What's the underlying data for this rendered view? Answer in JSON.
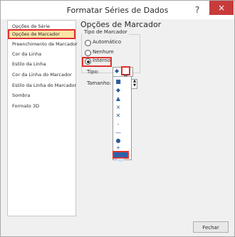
{
  "window": {
    "title": "Formatar Séries de Dados",
    "help": "?",
    "close": "×"
  },
  "sidebar": {
    "items": [
      {
        "label": "Opções de Série"
      },
      {
        "label": "Opções de Marcador"
      },
      {
        "label": "Preenchimento de Marcador"
      },
      {
        "label": "Cor da Linha"
      },
      {
        "label": "Estilo da Linha"
      },
      {
        "label": "Cor da Linha do Marcador"
      },
      {
        "label": "Estilo da Linha do Marcador"
      },
      {
        "label": "Sombra"
      },
      {
        "label": "Formato 3D"
      }
    ],
    "selected_index": 1
  },
  "main": {
    "title": "Opções de Marcador",
    "marker_type_group": "Tipo de Marcador",
    "options": [
      {
        "label": "Automático"
      },
      {
        "label": "Nenhum"
      },
      {
        "label": "Interno",
        "checked": true
      }
    ],
    "type_label": "Tipo:",
    "size_label": "Tamanho:",
    "type_current": "◆",
    "spinner_up": "▲",
    "spinner_down": "▼",
    "dropdown_items": [
      {
        "glyph": "■",
        "icon": "square-marker-icon"
      },
      {
        "glyph": "◆",
        "icon": "diamond-marker-icon"
      },
      {
        "glyph": "▲",
        "icon": "triangle-marker-icon"
      },
      {
        "glyph": "×",
        "icon": "x-marker-icon"
      },
      {
        "glyph": "✕",
        "icon": "star-marker-icon"
      },
      {
        "glyph": "-",
        "icon": "short-dash-marker-icon"
      },
      {
        "glyph": "—",
        "icon": "long-dash-marker-icon"
      },
      {
        "glyph": "●",
        "icon": "circle-marker-icon"
      },
      {
        "glyph": "+",
        "icon": "plus-marker-icon"
      }
    ]
  },
  "footer": {
    "close_label": "Fechar"
  },
  "colors": {
    "highlight": "#e03030",
    "selected_bg": "#fbe3a6",
    "marker": "#2e5b9a"
  }
}
